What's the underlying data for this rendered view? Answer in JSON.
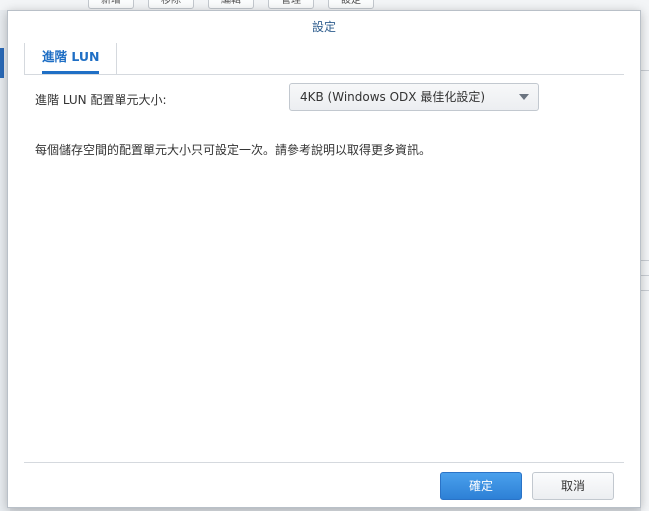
{
  "background": {
    "toolbar_buttons": [
      "新增",
      "移除",
      "編輯",
      "管理",
      "設定"
    ]
  },
  "dialog": {
    "title": "設定",
    "tabs": [
      {
        "label": "進階 LUN",
        "active": true
      }
    ],
    "form": {
      "block_size_label": "進階 LUN 配置單元大小:",
      "block_size_value": "4KB (Windows ODX 最佳化設定)"
    },
    "note": "每個儲存空間的配置單元大小只可設定一次。請參考說明以取得更多資訊。",
    "buttons": {
      "ok": "確定",
      "cancel": "取消"
    }
  },
  "colors": {
    "accent": "#1f6fc5",
    "primary_button": "#2d80d6",
    "title_text": "#2f5e8e"
  }
}
